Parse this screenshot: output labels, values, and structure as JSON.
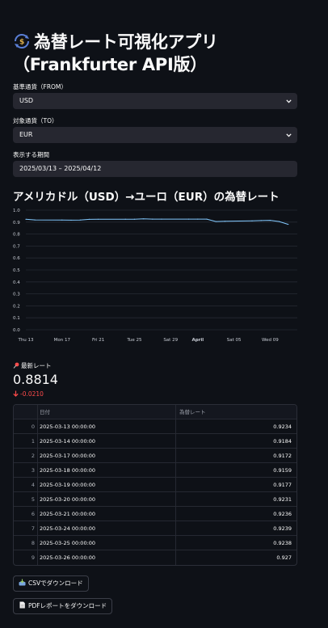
{
  "app": {
    "title_line1": "為替レート可視化アプリ",
    "title_line2": "（Frankfurter API版）"
  },
  "form": {
    "from_label": "基準通貨（FROM）",
    "from_value": "USD",
    "to_label": "対象通貨（TO）",
    "to_value": "EUR",
    "period_label": "表示する期間",
    "period_value": "2025/03/13 – 2025/04/12"
  },
  "chart_title": "アメリカドル（USD）→ユーロ（EUR）の為替レート",
  "chart_data": {
    "type": "line",
    "x": [
      "2025-03-13",
      "2025-03-14",
      "2025-03-17",
      "2025-03-18",
      "2025-03-19",
      "2025-03-20",
      "2025-03-21",
      "2025-03-24",
      "2025-03-25",
      "2025-03-26",
      "2025-03-27",
      "2025-03-28",
      "2025-03-31",
      "2025-04-01",
      "2025-04-02",
      "2025-04-03",
      "2025-04-04",
      "2025-04-07",
      "2025-04-08",
      "2025-04-09",
      "2025-04-10",
      "2025-04-11"
    ],
    "values": [
      0.9234,
      0.9184,
      0.9172,
      0.9159,
      0.9177,
      0.9231,
      0.9236,
      0.9239,
      0.9238,
      0.927,
      0.925,
      0.925,
      0.925,
      0.925,
      0.925,
      0.905,
      0.907,
      0.91,
      0.913,
      0.915,
      0.905,
      0.8814
    ],
    "x_ticks": [
      "Thu 13",
      "Mon 17",
      "Fri 21",
      "Tue 25",
      "Sat 29",
      "April",
      "Sat 05",
      "Wed 09"
    ],
    "y_ticks": [
      "0.0",
      "0.1",
      "0.2",
      "0.3",
      "0.4",
      "0.5",
      "0.6",
      "0.7",
      "0.8",
      "0.9",
      "1.0"
    ],
    "ylim": [
      0,
      1.0
    ],
    "line_color": "#83c9ff",
    "grid": true
  },
  "metric": {
    "label": "最新レート",
    "value": "0.8814",
    "delta": "-0.0210",
    "delta_color": "#ff4b4b"
  },
  "table": {
    "columns": [
      "日付",
      "為替レート"
    ],
    "rows": [
      {
        "index": "0",
        "date": "2025-03-13 00:00:00",
        "rate": "0.9234"
      },
      {
        "index": "1",
        "date": "2025-03-14 00:00:00",
        "rate": "0.9184"
      },
      {
        "index": "2",
        "date": "2025-03-17 00:00:00",
        "rate": "0.9172"
      },
      {
        "index": "3",
        "date": "2025-03-18 00:00:00",
        "rate": "0.9159"
      },
      {
        "index": "4",
        "date": "2025-03-19 00:00:00",
        "rate": "0.9177"
      },
      {
        "index": "5",
        "date": "2025-03-20 00:00:00",
        "rate": "0.9231"
      },
      {
        "index": "6",
        "date": "2025-03-21 00:00:00",
        "rate": "0.9236"
      },
      {
        "index": "7",
        "date": "2025-03-24 00:00:00",
        "rate": "0.9239"
      },
      {
        "index": "8",
        "date": "2025-03-25 00:00:00",
        "rate": "0.9238"
      },
      {
        "index": "9",
        "date": "2025-03-26 00:00:00",
        "rate": "0.927"
      }
    ]
  },
  "buttons": {
    "csv": "CSVでダウンロード",
    "pdf": "PDFレポートをダウンロード"
  },
  "icons": {
    "title": "currency-exchange-icon",
    "metric": "pushpin-icon",
    "delta": "arrow-down-icon",
    "csv": "inbox-tray-icon",
    "pdf": "document-icon"
  }
}
